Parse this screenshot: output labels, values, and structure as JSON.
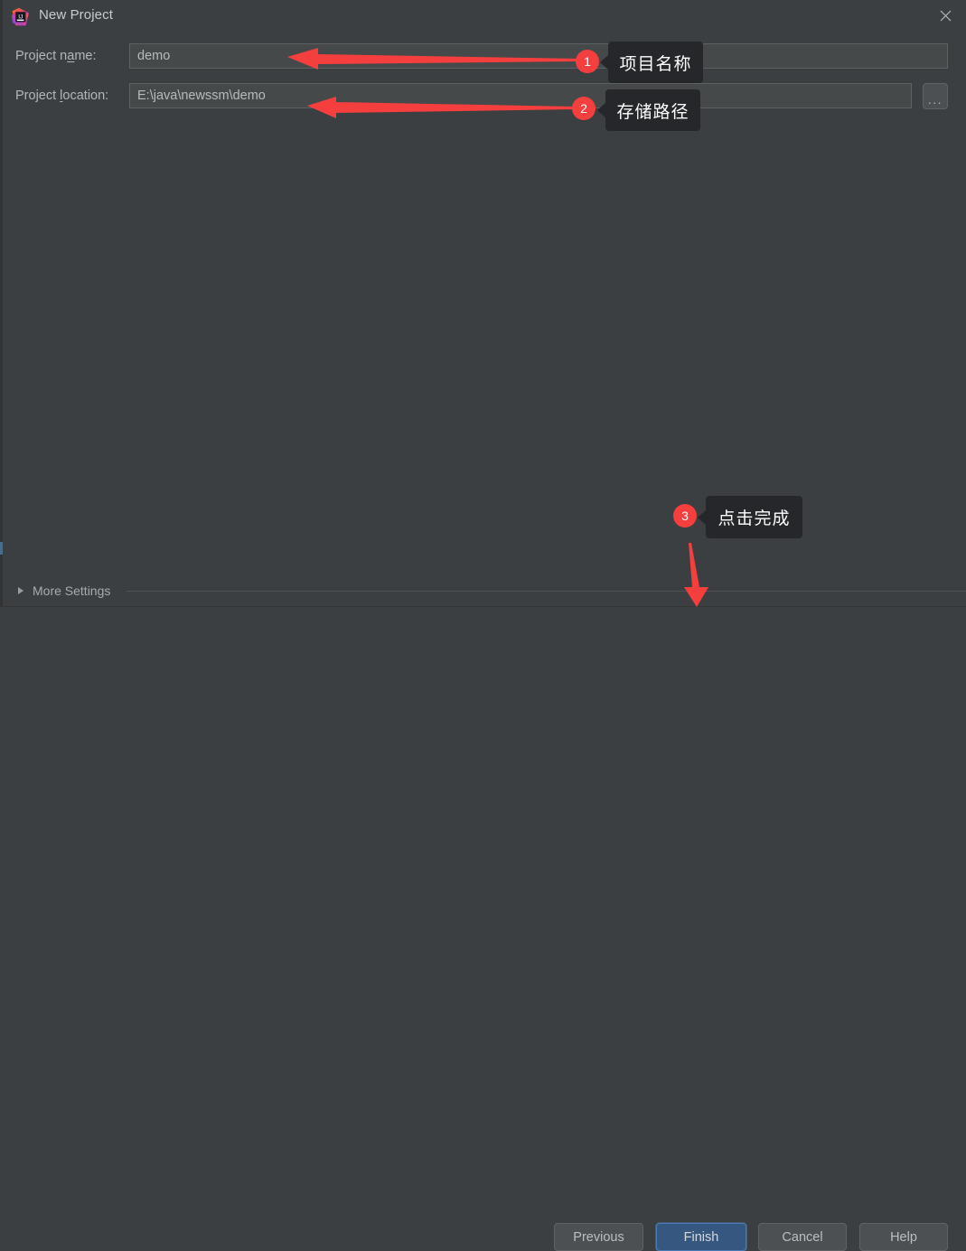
{
  "window": {
    "title": "New Project",
    "app_icon": "intellij-idea-icon",
    "close_icon": "close-icon"
  },
  "form": {
    "name_label_pre": "Project n",
    "name_label_mnemonic": "a",
    "name_label_post": "me:",
    "name_label_full": "Project name:",
    "name_value": "demo",
    "location_label_pre": "Project ",
    "location_label_mnemonic": "l",
    "location_label_post": "ocation:",
    "location_label_full": "Project location:",
    "location_value": "E:\\java\\newssm\\demo",
    "browse_label": "...",
    "browse_icon": "ellipsis-icon"
  },
  "more_settings": {
    "label": "More Settings",
    "expand_icon": "triangle-right-icon",
    "expanded": false
  },
  "footer": {
    "previous_label": "Previous",
    "finish_label": "Finish",
    "cancel_label": "Cancel",
    "help_label": "Help"
  },
  "annotations": {
    "accent_color": "#f53e3e",
    "tooltip_bg": "#25272a",
    "items": [
      {
        "number": "1",
        "text": "项目名称",
        "target": "project-name-field",
        "arrow": "arrow-left"
      },
      {
        "number": "2",
        "text": "存储路径",
        "target": "project-location-field",
        "arrow": "arrow-left"
      },
      {
        "number": "3",
        "text": "点击完成",
        "target": "finish-button",
        "arrow": "arrow-down"
      }
    ]
  },
  "theme": {
    "background": "#3c3f41",
    "field_background": "#45494a",
    "button_background": "#4c5052",
    "primary_button": "#365880",
    "text": "#bbbbbb"
  }
}
